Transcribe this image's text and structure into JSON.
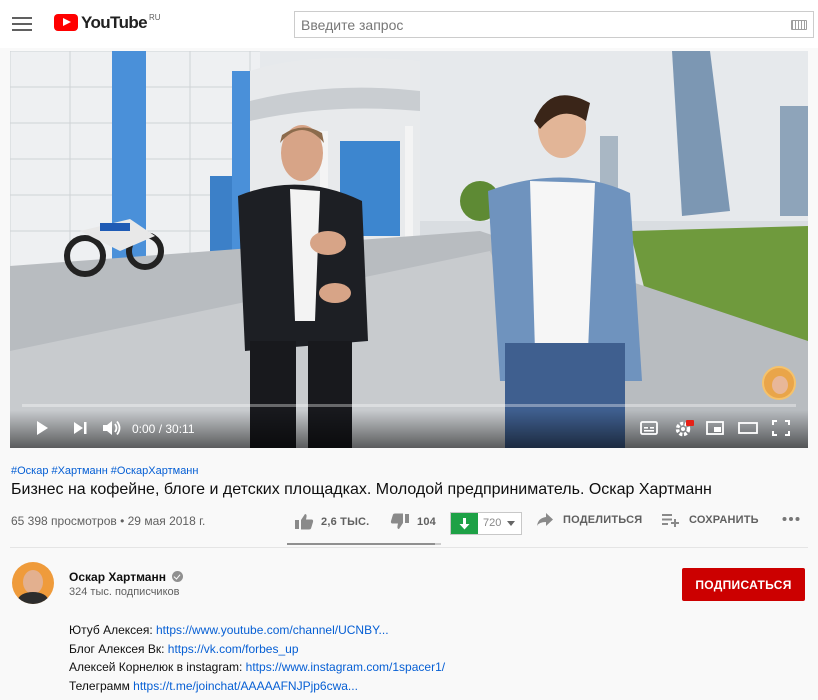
{
  "header": {
    "logo_text": "YouTube",
    "logo_region": "RU",
    "search_placeholder": "Введите запрос"
  },
  "player": {
    "time": "0:00 / 30:11",
    "progress": 0.0
  },
  "video": {
    "hashtags": [
      "#Оскар",
      "#Хартманн",
      "#ОскарХартманн"
    ],
    "title": "Бизнес на кофейне, блоге и детских площадках. Молодой предприниматель. Оскар Хартманн",
    "meta": "65 398 просмотров • 29 мая 2018 г.",
    "likes": "2,6 ТЫС.",
    "dislikes": "104",
    "downloads": "720",
    "share_label": "ПОДЕЛИТЬСЯ",
    "save_label": "СОХРАНИТЬ",
    "like_ratio": 0.96
  },
  "channel": {
    "name": "Оскар Хартманн",
    "subscribers": "324 тыс. подписчиков",
    "subscribe_label": "ПОДПИСАТЬСЯ"
  },
  "description": [
    {
      "label": "Ютуб Алексея: ",
      "link": "https://www.youtube.com/channel/UCNBY..."
    },
    {
      "label": "Блог Алексея Вк: ",
      "link": "https://vk.com/forbes_up"
    },
    {
      "label": "Алексей Корнелюк в instagram: ",
      "link": "https://www.instagram.com/1spacer1/"
    },
    {
      "label": "Телеграмм ",
      "link": "https://t.me/joinchat/AAAAAFNJPjp6cwa..."
    }
  ],
  "colors": {
    "brand_red": "#ff0000",
    "subscribe_red": "#cc0000",
    "link_blue": "#065fd4",
    "download_green": "#1ea146"
  }
}
